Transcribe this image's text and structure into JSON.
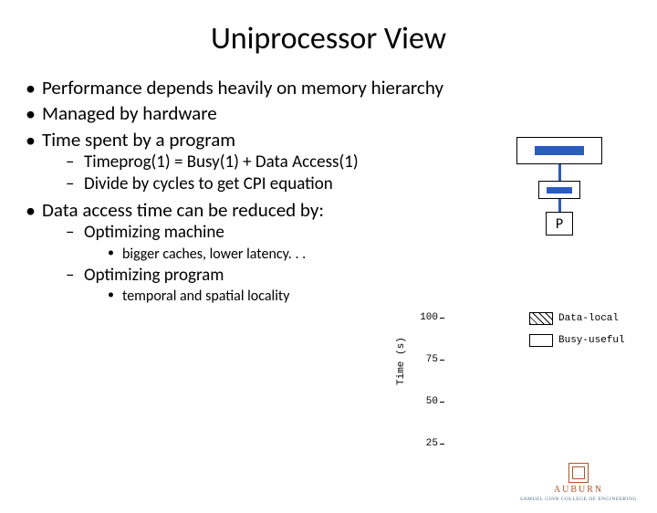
{
  "title": "Uniprocessor View",
  "bullets": {
    "b1": "Performance depends heavily on memory hierarchy",
    "b2": "Managed by hardware",
    "b3": "Time spent by a program",
    "b3_sub": {
      "s1": "Timeprog(1) = Busy(1) + Data Access(1)",
      "s2": "Divide by cycles to get CPI equation"
    },
    "b4": "Data access time can be reduced by:",
    "b4_sub": {
      "s1": "Optimizing machine",
      "s1_ss": {
        "x1": "bigger caches, lower latency. . ."
      },
      "s2": "Optimizing program",
      "s2_ss": {
        "x1": "temporal and spatial locality"
      }
    }
  },
  "diagram": {
    "p_label": "P"
  },
  "chart_data": {
    "type": "bar",
    "categories": [],
    "series": [
      {
        "name": "Data-local",
        "values": []
      },
      {
        "name": "Busy-useful",
        "values": []
      }
    ],
    "title": "",
    "xlabel": "",
    "ylabel": "Time (s)",
    "ylim": [
      0,
      100
    ],
    "yticks": [
      25,
      50,
      75,
      100
    ]
  },
  "legend": {
    "item1": "Data-local",
    "item2": "Busy-useful"
  },
  "logo": {
    "name": "AUBURN",
    "sub": "SAMUEL GINN COLLEGE OF ENGINEERING"
  }
}
